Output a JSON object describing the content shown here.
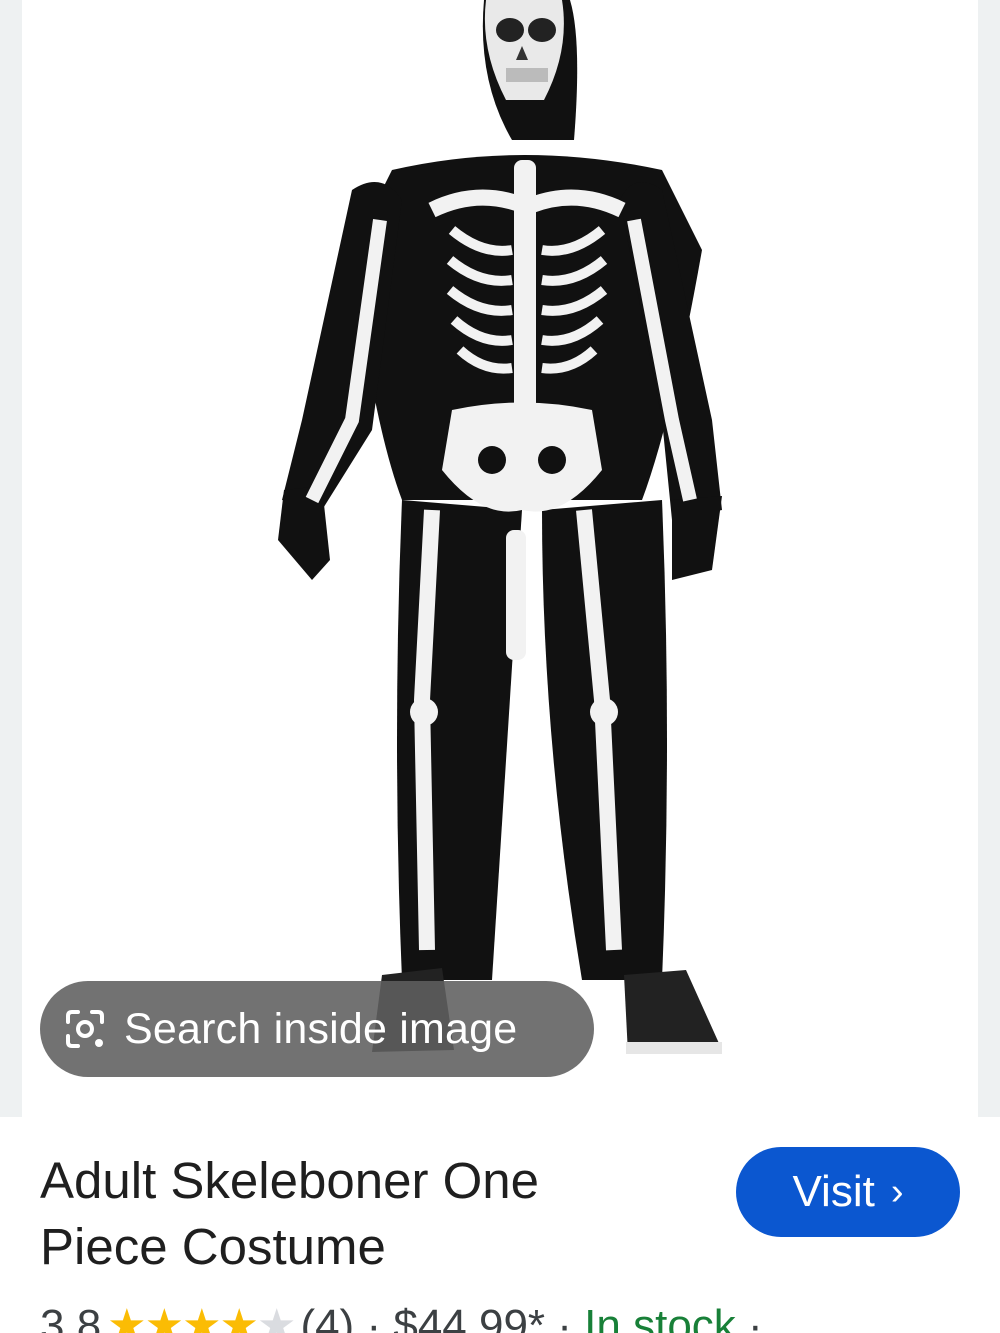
{
  "image": {
    "alt": "Adult Skeleboner One Piece Costume",
    "lens_icon": "lens-camera-icon"
  },
  "lens": {
    "label": "Search inside image"
  },
  "product": {
    "title": "Adult Skeleboner One Piece Costume",
    "rating": "3.8",
    "stars_filled": 4,
    "stars_total": 5,
    "review_count": "(4)",
    "price": "$44.99*",
    "stock_status": "In stock",
    "separator": "·"
  },
  "visit": {
    "label": "Visit",
    "chevron": "›"
  },
  "colors": {
    "visit_button": "#0b57d0",
    "in_stock": "#188038",
    "stars": "#fbbc04"
  }
}
